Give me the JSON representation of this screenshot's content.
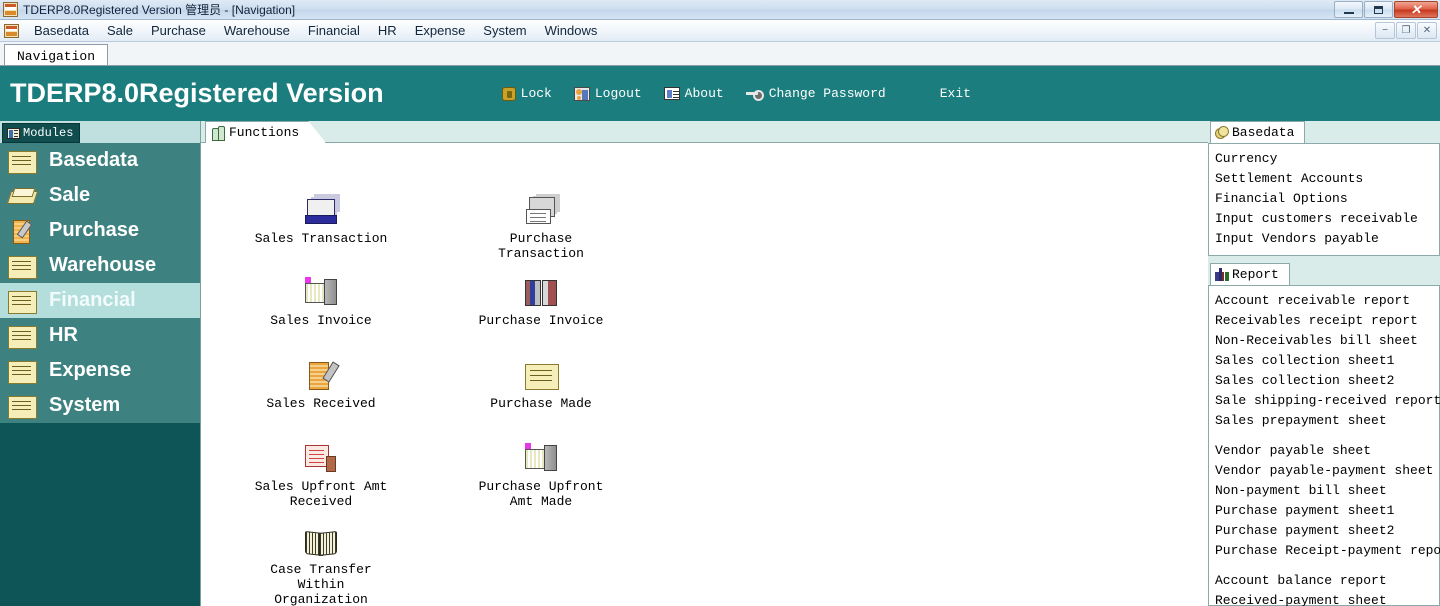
{
  "window": {
    "title": "TDERP8.0Registered Version 管理员 - [Navigation]",
    "app_icon": "erp-app-icon",
    "controls": {
      "minimize": "minimize-icon",
      "maximize": "maximize-icon",
      "close": "close-icon"
    }
  },
  "menubar": {
    "icon": "erp-mdi-icon",
    "items": [
      "Basedata",
      "Sale",
      "Purchase",
      "Warehouse",
      "Financial",
      "HR",
      "Expense",
      "System",
      "Windows"
    ],
    "mdi_controls": {
      "minimize": "−",
      "restore": "❐",
      "close": "✕"
    }
  },
  "doctabs": {
    "tabs": [
      "Navigation"
    ],
    "active": "Navigation"
  },
  "banner": {
    "title": "TDERP8.0Registered Version",
    "background": "#1b7d7d",
    "tools": [
      {
        "label": "Lock",
        "icon": "lock-icon"
      },
      {
        "label": "Logout",
        "icon": "logout-icon"
      },
      {
        "label": "About",
        "icon": "about-icon"
      },
      {
        "label": "Change Password",
        "icon": "key-icon"
      },
      {
        "label": "Exit",
        "icon": ""
      }
    ]
  },
  "sidebar": {
    "tab_label": "Modules",
    "tab_icon": "grid-icon",
    "active_item": "Financial",
    "highlight_color": "#b3dedb",
    "item_color": "#3d8281",
    "background": "#0d5557",
    "items": [
      {
        "label": "Basedata",
        "icon": "folder-icon"
      },
      {
        "label": "Sale",
        "icon": "sale-book-icon"
      },
      {
        "label": "Purchase",
        "icon": "notepad-pencil-icon"
      },
      {
        "label": "Warehouse",
        "icon": "folder-icon"
      },
      {
        "label": "Financial",
        "icon": "folder-icon"
      },
      {
        "label": "HR",
        "icon": "folder-icon"
      },
      {
        "label": "Expense",
        "icon": "folder-icon"
      },
      {
        "label": "System",
        "icon": "folder-icon"
      }
    ]
  },
  "functions_panel": {
    "tab_label": "Functions",
    "tab_icon": "functions-icon",
    "items": [
      {
        "label": "Sales Transaction",
        "icon": "sales-transaction-icon",
        "col": 0,
        "row": 0
      },
      {
        "label": "Purchase\nTransaction",
        "icon": "purchase-transaction-icon",
        "col": 1,
        "row": 0
      },
      {
        "label": "Sales Invoice",
        "icon": "sales-invoice-icon",
        "col": 0,
        "row": 1
      },
      {
        "label": "Purchase Invoice",
        "icon": "purchase-invoice-icon",
        "col": 1,
        "row": 1
      },
      {
        "label": "Sales Received",
        "icon": "sales-received-icon",
        "col": 0,
        "row": 2
      },
      {
        "label": "Purchase Made",
        "icon": "purchase-made-icon",
        "col": 1,
        "row": 2
      },
      {
        "label": "Sales Upfront Amt\nReceived",
        "icon": "sales-upfront-icon",
        "col": 0,
        "row": 3
      },
      {
        "label": "Purchase Upfront\nAmt Made",
        "icon": "purchase-upfront-icon",
        "col": 1,
        "row": 3
      },
      {
        "label": "Case Transfer\nWithin\nOrganization",
        "icon": "book-icon",
        "col": 0,
        "row": 4
      }
    ]
  },
  "basedata_panel": {
    "tab_label": "Basedata",
    "tab_icon": "coins-icon",
    "items": [
      "Currency",
      "Settlement Accounts",
      "Financial Options",
      "Input customers receivable",
      "Input Vendors payable"
    ]
  },
  "report_panel": {
    "tab_label": "Report",
    "tab_icon": "bar-chart-icon",
    "items": [
      "Account receivable report",
      "Receivables receipt report",
      "Non-Receivables bill sheet",
      "Sales collection sheet1",
      "Sales collection sheet2",
      "Sale shipping-received report",
      "Sales prepayment sheet",
      "",
      "Vendor payable sheet",
      "Vendor payable-payment sheet",
      "Non-payment bill sheet",
      "Purchase payment sheet1",
      "Purchase payment sheet2",
      "Purchase Receipt-payment report",
      "",
      "Account balance report",
      "Received-payment sheet"
    ]
  }
}
